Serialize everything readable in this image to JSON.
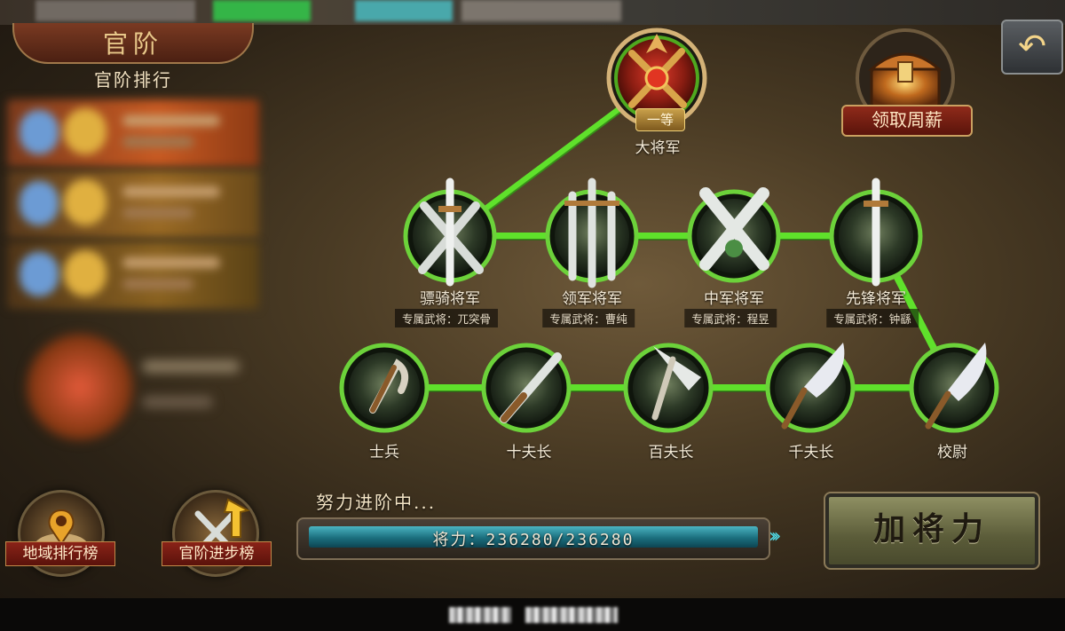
{
  "panel": {
    "header_title": "官阶",
    "ranking_title": "官阶排行"
  },
  "bottom_buttons": {
    "region_rank": "地域排行榜",
    "rank_progress": "官阶进步榜"
  },
  "top_rank": {
    "badge": "一等",
    "name": "大将军"
  },
  "weekly_salary": "领取周薪",
  "middle_row": [
    {
      "name": "骠骑将军",
      "exclusive": "专属武将：兀突骨"
    },
    {
      "name": "领军将军",
      "exclusive": "专属武将：曹纯"
    },
    {
      "name": "中军将军",
      "exclusive": "专属武将：程昱"
    },
    {
      "name": "先锋将军",
      "exclusive": "专属武将：钟繇"
    }
  ],
  "bottom_row": [
    {
      "name": "士兵"
    },
    {
      "name": "十夫长"
    },
    {
      "name": "百夫长"
    },
    {
      "name": "千夫长"
    },
    {
      "name": "校尉"
    }
  ],
  "progress": {
    "caption": "努力进阶中...",
    "text": "将力：236280/236280",
    "current": 236280,
    "max": 236280
  },
  "add_button": "加将力",
  "back_icon": "back-arrow-icon",
  "colors": {
    "path_green": "#5fe12b",
    "bar_teal": "#2a8fa0",
    "ribbon_red": "#7a1d12"
  }
}
